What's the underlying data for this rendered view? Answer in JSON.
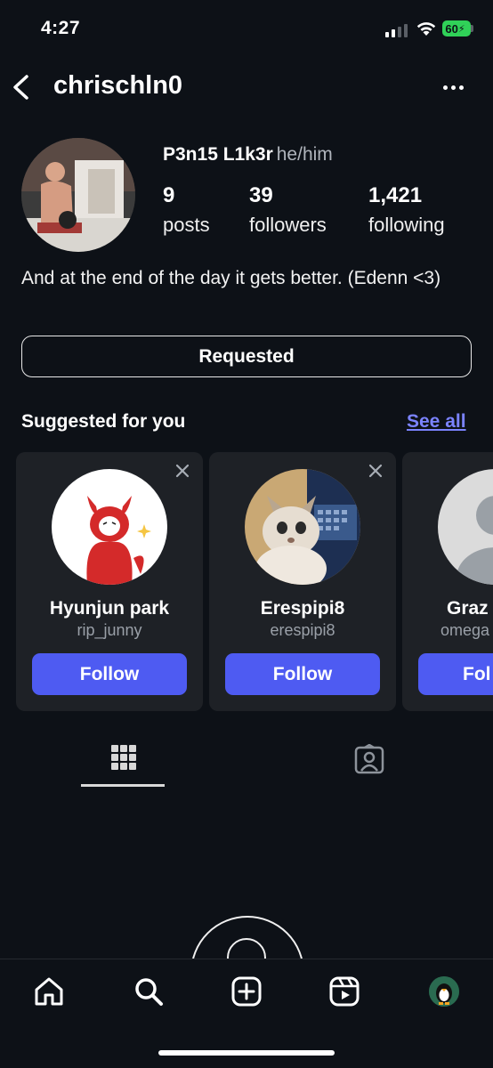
{
  "status_bar": {
    "time": "4:27",
    "battery": "60"
  },
  "header": {
    "username": "chrischln0"
  },
  "profile": {
    "display_name": "P3n15 L1k3r",
    "pronouns": "he/him",
    "stats": [
      {
        "value": "9",
        "label": "posts"
      },
      {
        "value": "39",
        "label": "followers"
      },
      {
        "value": "1,421",
        "label": "following"
      }
    ],
    "bio": "And at the end of the day it gets better. (Edenn <3)",
    "action_label": "Requested"
  },
  "suggested": {
    "title": "Suggested for you",
    "see_all": "See all",
    "cards": [
      {
        "name": "Hyunjun park",
        "handle": "rip_junny",
        "button": "Follow"
      },
      {
        "name": "Erespipi8",
        "handle": "erespipi8",
        "button": "Follow"
      },
      {
        "name": "Graz",
        "handle": "omega",
        "button": "Fol"
      }
    ]
  },
  "icons": {
    "back": "chevron-left-icon",
    "more": "more-horizontal-icon",
    "close": "close-icon",
    "grid": "grid-icon",
    "tagged": "tagged-person-icon",
    "home": "home-icon",
    "search": "search-icon",
    "create": "plus-square-icon",
    "reels": "reels-icon"
  },
  "colors": {
    "background": "#0d1117",
    "card": "#1e2126",
    "accent_button": "#4e5bf2",
    "link": "#7b83ff",
    "battery": "#30d158"
  }
}
